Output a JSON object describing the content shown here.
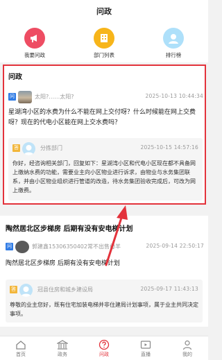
{
  "page_title": "问政",
  "shortcuts": [
    {
      "label": "我要问政",
      "icon": "megaphone-icon"
    },
    {
      "label": "部门列表",
      "icon": "building-list-icon"
    },
    {
      "label": "排行榜",
      "icon": "ranking-avatar-icon"
    }
  ],
  "section1": {
    "title": "问政",
    "post": {
      "tag": "问",
      "user": "太阳?……太阳?",
      "time": "2025-10-13  10:44:34",
      "question": "星湖湾小区的水费为什么不能在网上交付呀？什么时候能在网上交费呀？现在的代电小区能在网上交水费吗？",
      "reply": {
        "tag": "答",
        "dept": "分拣部门",
        "time": "2025-10-15  14:57:16",
        "text": "你好，经咨询相关部门，回复如下：星湖湾小区和代电小区现在都不具备网上缴纳水费的功能，需要业主向小区物业进行诉求，由物业与水务集团联系，并由小区物业组织进行管道的改造，待水务集团验收完成后，可改为网上缴费。"
      }
    }
  },
  "section2": {
    "title": "陶然居北区步梯房   后期有没有安电梯计划",
    "post": {
      "tag": "问",
      "user": "郭建鑫15306350402常不出售母羊",
      "time": "2025-09-14  22:50:17",
      "question": "陶然居北区步梯房   后期有没有安电梯计划",
      "reply": {
        "tag": "答",
        "dept": "冠县住房和城乡建设局",
        "time": "2025-09-17  11:43:13",
        "text": "尊敬的业主您好，既有住宅加装电梯并非住建局计划事项，属于业主共同决定事项。"
      }
    }
  },
  "tabs": [
    {
      "label": "首页",
      "icon": "home-icon"
    },
    {
      "label": "政务",
      "icon": "government-building-icon"
    },
    {
      "label": "问政",
      "icon": "question-circle-icon",
      "active": true
    },
    {
      "label": "直播",
      "icon": "live-tv-icon"
    },
    {
      "label": "我的",
      "icon": "user-icon"
    }
  ],
  "colors": {
    "accent": "#e3323b",
    "ask_tag": "#2f7be5",
    "reply_tag": "#f2b63a"
  }
}
